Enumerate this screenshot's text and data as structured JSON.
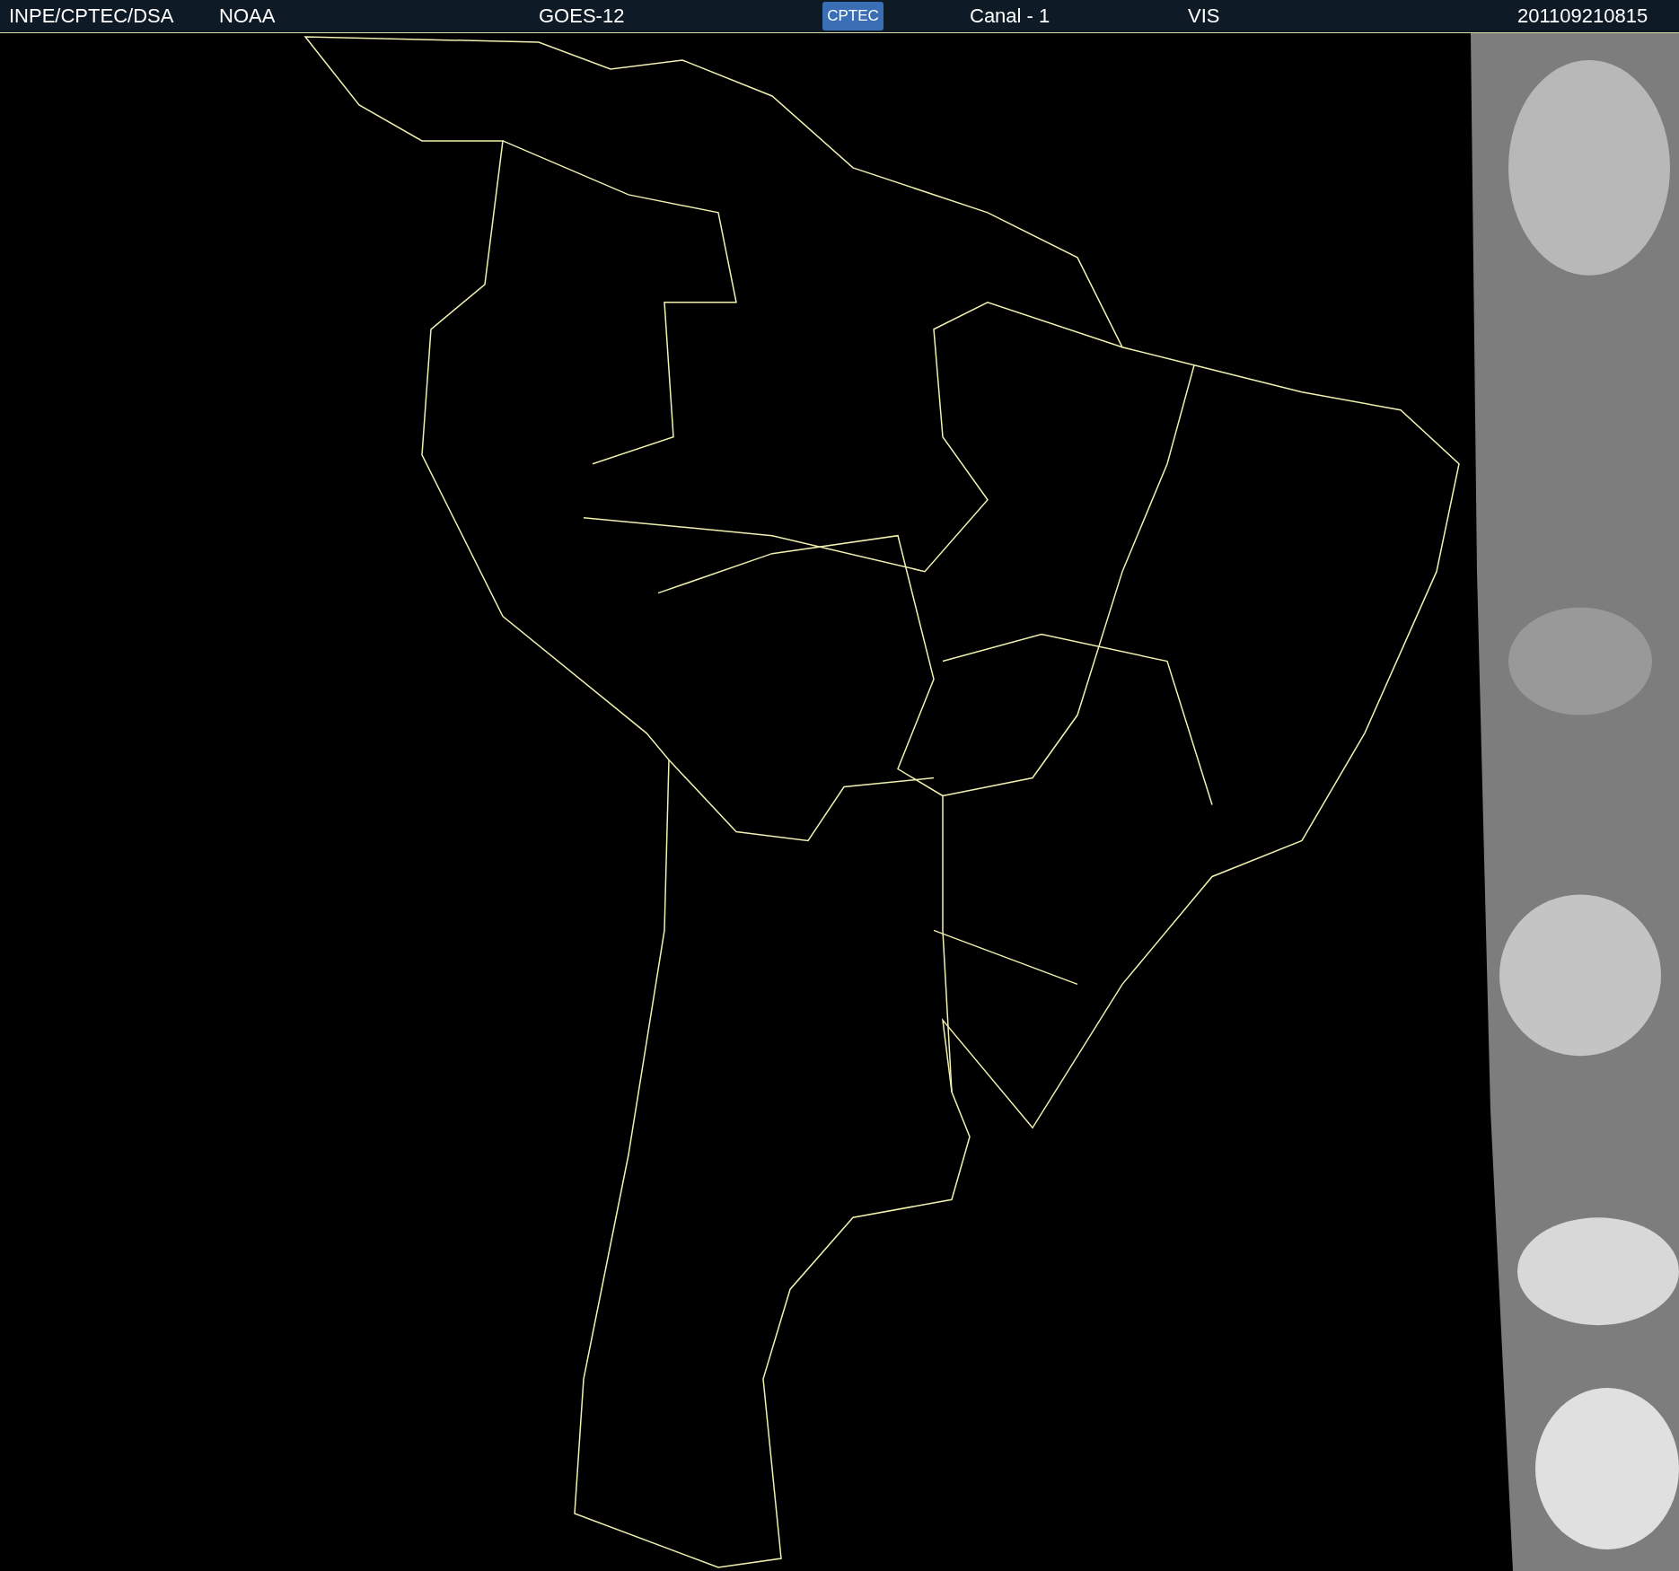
{
  "header": {
    "source": "INPE/CPTEC/DSA",
    "agency": "NOAA",
    "satellite": "GOES-12",
    "logo_text": "CPTEC",
    "channel": "Canal - 1",
    "band": "VIS",
    "timestamp": "201109210815"
  }
}
